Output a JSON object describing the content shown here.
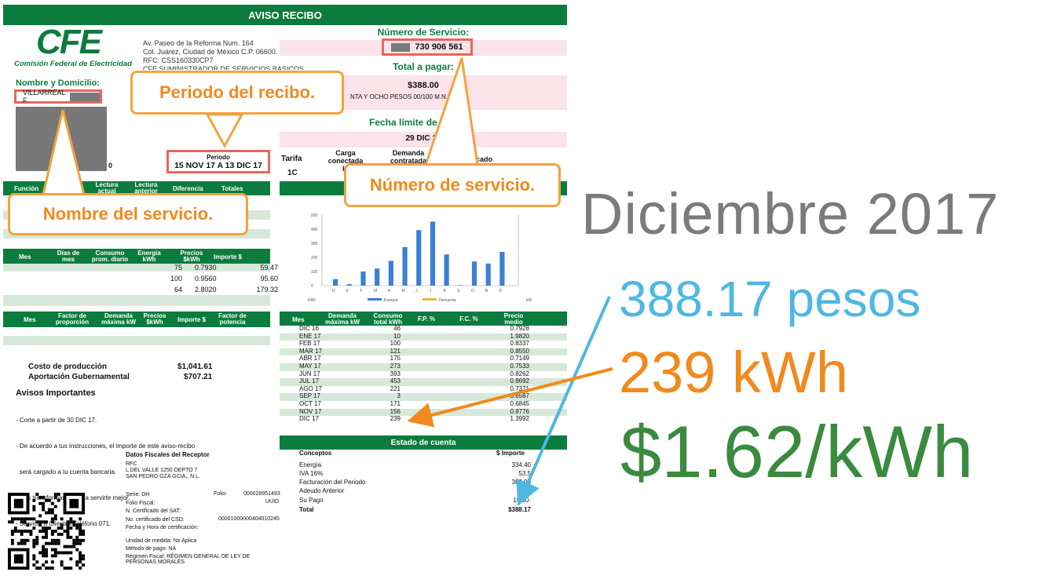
{
  "receipt": {
    "title": "AVISO RECIBO",
    "brand": {
      "logo_text": "CFE",
      "name": "Comisión Federal de Electricidad"
    },
    "address_lines": [
      "Av. Paseo de la Reforma Num. 164",
      "Col. Juárez, Ciudad de México C.P. 06600.",
      "RFC: CSS160330CP7",
      "CFE SUMINISTRADOR DE SERVICIOS BASICOS"
    ],
    "customer": {
      "label": "Nombre y Domicilio:",
      "name": "VILLARREAL F",
      "fragment": "0"
    },
    "period": {
      "label": "Periodo",
      "value": "15 NOV 17 A 13 DIC 17"
    },
    "service": {
      "label": "Número de Servicio:",
      "number": "730 906 561"
    },
    "total_to_pay": {
      "label": "Total a pagar:",
      "amount": "$388.00",
      "words": "NTA Y OCHO PESOS 00/100 M.N.)"
    },
    "due_date": {
      "label": "Fecha límite de p",
      "value": "29 DIC 17"
    },
    "tariff": {
      "labels": [
        "Tarifa",
        "Carga conectada",
        "Demanda contratada",
        "cado"
      ],
      "value": "1C",
      "fragment": "k"
    },
    "readings_header": [
      "Función",
      "Lectura actual",
      "Lectura anterior",
      "Diferencia",
      "Totales"
    ],
    "consumption_header": [
      "Mes",
      "Días de mes",
      "Consumo prom. diario",
      "Energía kWh",
      "Precios $kWh",
      "Importe $"
    ],
    "consumption_rows": [
      {
        "energy": "75",
        "price": "0.7930",
        "amount": "59.47"
      },
      {
        "energy": "100",
        "price": "0.9560",
        "amount": "95.60"
      },
      {
        "energy": "64",
        "price": "2.8020",
        "amount": "179.32"
      }
    ],
    "demand_header": [
      "Mes",
      "Factor de proporción",
      "Demanda máxima kW",
      "Precios $kWh",
      "Importe $",
      "Factor de potencia"
    ],
    "production": {
      "label": "Costo de producción",
      "value": "$1,041.61"
    },
    "subsidy": {
      "label": "Aportación Gubernamental",
      "value": "$707.21"
    },
    "notices": {
      "title": "Avisos Importantes",
      "items": [
        "- Corte a partir de 30 DIC 17.",
        "- De acuerdo a tus instrucciones, el importe de este aviso-recibo",
        "  será cargado a tu cuenta bancaria.",
        "- Nos transformamos para servirte mejor.",
        "- Servicio a Clientes Teléfono 071."
      ]
    },
    "fiscal": {
      "title": "Datos Fiscales del Receptor",
      "lines": [
        "RFC",
        "L DEL VALLE 1250 DEPTO 7",
        "SAN PEDRO GZA GCIA,, N.L."
      ],
      "serie_label": "Serie: DH",
      "folio_label": "Folio:",
      "folio_value": "000028951493",
      "fiscal_label": "Folio Fiscal:",
      "uuid": "UUID",
      "sat": "N. Certificado del SAT:",
      "csd_label": "No. certificado del CSD:",
      "csd_value": "00001000000404010245",
      "cert_date": "Fecha y Hora de certificación:",
      "unit": "Unidad de medida: No Aplica",
      "method": "Método de pago: NA",
      "regime": "Régimen Fiscal: RÉGIMEN GENERAL DE LEY DE PERSONAS MORALES"
    },
    "history_header": [
      "Mes",
      "Demanda máxima kW",
      "Consumo total kWh",
      "F.P. %",
      "F.C. %",
      "Precio medio"
    ],
    "history": [
      {
        "month": "DIC 16",
        "kwh": "46",
        "price": "0.7928"
      },
      {
        "month": "ENE 17",
        "kwh": "10",
        "price": "1.9820"
      },
      {
        "month": "FEB 17",
        "kwh": "100",
        "price": "0.8337"
      },
      {
        "month": "MAR 17",
        "kwh": "121",
        "price": "0.8550"
      },
      {
        "month": "ABR 17",
        "kwh": "175",
        "price": "0.7149"
      },
      {
        "month": "MAY 17",
        "kwh": "273",
        "price": "0.7533"
      },
      {
        "month": "JUN 17",
        "kwh": "393",
        "price": "0.8262"
      },
      {
        "month": "JUL 17",
        "kwh": "453",
        "price": "0.8692"
      },
      {
        "month": "AGO 17",
        "kwh": "221",
        "price": "0.7371"
      },
      {
        "month": "SEP 17",
        "kwh": "3",
        "price": "3.6567"
      },
      {
        "month": "OCT 17",
        "kwh": "171",
        "price": "0.6845"
      },
      {
        "month": "NOV 17",
        "kwh": "156",
        "price": "0.8776"
      },
      {
        "month": "DIC 17",
        "kwh": "239",
        "price": "1.3992"
      }
    ],
    "account": {
      "title": "Estado de cuenta",
      "col_concept": "Conceptos",
      "col_amount": "$ Importe",
      "rows": [
        {
          "concept": "Energía",
          "amount": "334.40"
        },
        {
          "concept": "IVA 16%",
          "amount": "53.5"
        },
        {
          "concept": "Facturación del Periodo",
          "amount": "387.90"
        },
        {
          "concept": "Adeudo Anterior",
          "amount": "1"
        },
        {
          "concept": "Su Pago",
          "amount": "15.00-"
        },
        {
          "concept": "Total",
          "amount": "$388.17"
        }
      ]
    },
    "mini_chart": {
      "y_ticks": [
        "500",
        "400",
        "300",
        "200",
        "100",
        "0"
      ],
      "x_labels": [
        "D",
        "E",
        "F",
        "M",
        "A",
        "M",
        "J",
        "J",
        "A",
        "S",
        "O",
        "N",
        "D"
      ],
      "x_left": "kWh",
      "x_right": "kW",
      "legend": [
        "Energía",
        "Demanda"
      ]
    }
  },
  "callouts": {
    "period": "Periodo del recibo.",
    "service": "Número de servicio.",
    "name": "Nombre del servicio."
  },
  "summary": {
    "month": "Diciembre 2017",
    "pesos": "388.17 pesos",
    "kwh": "239 kWh",
    "rate": "$1.62/kWh"
  },
  "colors": {
    "green": "#0c7c3e",
    "orange": "#f08a1d",
    "blue": "#4fb7e3",
    "grey": "#7b7b7b",
    "summary_green": "#3a8b3f"
  }
}
